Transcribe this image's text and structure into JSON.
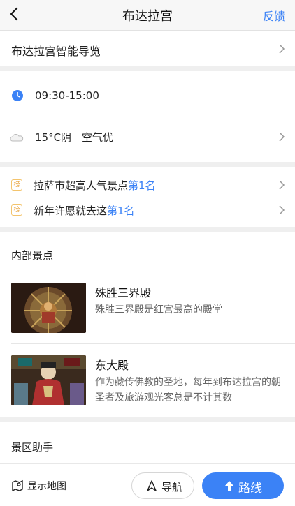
{
  "header": {
    "title": "布达拉宫",
    "feedback": "反馈",
    "back_icon": "back-arrow-icon"
  },
  "guide": {
    "label": "布达拉宫智能导览"
  },
  "hours": {
    "time": "09:30-15:00",
    "icon": "clock-icon"
  },
  "weather": {
    "temp": "15°C阴",
    "air": "空气优",
    "icon": "cloud-icon"
  },
  "rankings": [
    {
      "badge": "榜",
      "text": "拉萨市超高人气景点",
      "rank": "第1名"
    },
    {
      "badge": "榜",
      "text": "新年许愿就去这",
      "rank": "第1名"
    }
  ],
  "inner": {
    "heading": "内部景点",
    "spots": [
      {
        "title": "殊胜三界殿",
        "desc": "殊胜三界殿是红宫最高的殿堂"
      },
      {
        "title": "东大殿",
        "desc": "作为藏传佛教的圣地，每年到布达拉宫的朝圣者及旅游观光客总是不计其数"
      }
    ]
  },
  "assistant": {
    "heading": "景区助手"
  },
  "bottom": {
    "show_map": "显示地图",
    "navigate": "导航",
    "route": "路线"
  },
  "colors": {
    "accent": "#3b82f6",
    "badge": "#e8a23a"
  }
}
